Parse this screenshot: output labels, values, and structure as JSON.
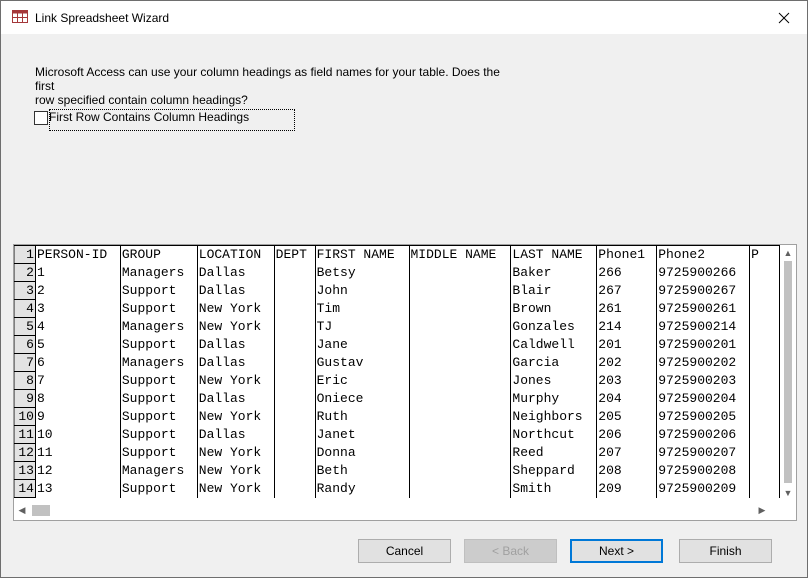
{
  "window": {
    "title": "Link Spreadsheet Wizard"
  },
  "prompt": {
    "line1": "Microsoft Access can use your column headings as field names for your table. Does the first",
    "line2": "row specified contain column headings?"
  },
  "checkbox": {
    "label": "First Row Contains Column Headings",
    "checked": false
  },
  "grid": {
    "columns": [
      "PERSON-ID",
      "GROUP",
      "LOCATION",
      "DEPT",
      "FIRST NAME",
      "MIDDLE NAME",
      "LAST NAME",
      "Phone1",
      "Phone2",
      "P"
    ],
    "rows": [
      {
        "n": "1",
        "cells": [
          "PERSON-ID",
          "GROUP",
          "LOCATION",
          "DEPT",
          "FIRST NAME",
          "MIDDLE NAME",
          "LAST NAME",
          "Phone1",
          "Phone2",
          "P"
        ]
      },
      {
        "n": "2",
        "cells": [
          "1",
          "Managers",
          "Dallas",
          "",
          "Betsy",
          "",
          "Baker",
          "266",
          "9725900266",
          ""
        ]
      },
      {
        "n": "3",
        "cells": [
          "2",
          "Support",
          "Dallas",
          "",
          "John",
          "",
          "Blair",
          "267",
          "9725900267",
          ""
        ]
      },
      {
        "n": "4",
        "cells": [
          "3",
          "Support",
          "New York",
          "",
          "Tim",
          "",
          "Brown",
          "261",
          "9725900261",
          ""
        ]
      },
      {
        "n": "5",
        "cells": [
          "4",
          "Managers",
          "New York",
          "",
          "TJ",
          "",
          "Gonzales",
          "214",
          "9725900214",
          ""
        ]
      },
      {
        "n": "6",
        "cells": [
          "5",
          "Support",
          "Dallas",
          "",
          "Jane",
          "",
          "Caldwell",
          "201",
          "9725900201",
          ""
        ]
      },
      {
        "n": "7",
        "cells": [
          "6",
          "Managers",
          "Dallas",
          "",
          "Gustav",
          "",
          "Garcia",
          "202",
          "9725900202",
          ""
        ]
      },
      {
        "n": "8",
        "cells": [
          "7",
          "Support",
          "New York",
          "",
          "Eric",
          "",
          "Jones",
          "203",
          "9725900203",
          ""
        ]
      },
      {
        "n": "9",
        "cells": [
          "8",
          "Support",
          "Dallas",
          "",
          "Oniece",
          "",
          "Murphy",
          "204",
          "9725900204",
          ""
        ]
      },
      {
        "n": "10",
        "cells": [
          "9",
          "Support",
          "New York",
          "",
          "Ruth",
          "",
          "Neighbors",
          "205",
          "9725900205",
          ""
        ]
      },
      {
        "n": "11",
        "cells": [
          "10",
          "Support",
          "Dallas",
          "",
          "Janet",
          "",
          "Northcut",
          "206",
          "9725900206",
          ""
        ]
      },
      {
        "n": "12",
        "cells": [
          "11",
          "Support",
          "New York",
          "",
          "Donna",
          "",
          "Reed",
          "207",
          "9725900207",
          ""
        ]
      },
      {
        "n": "13",
        "cells": [
          "12",
          "Managers",
          "New York",
          "",
          "Beth",
          "",
          "Sheppard",
          "208",
          "9725900208",
          ""
        ]
      },
      {
        "n": "14",
        "cells": [
          "13",
          "Support",
          "New York",
          "",
          "Randy",
          "",
          "Smith",
          "209",
          "9725900209",
          ""
        ]
      }
    ]
  },
  "buttons": {
    "cancel": "Cancel",
    "back": "< Back",
    "next": "Next >",
    "finish": "Finish"
  },
  "icons": {
    "app": "access-table-icon",
    "close": "close-icon"
  },
  "colors": {
    "accent": "#0078d7",
    "rownum_bg": "#e3e3e3"
  }
}
